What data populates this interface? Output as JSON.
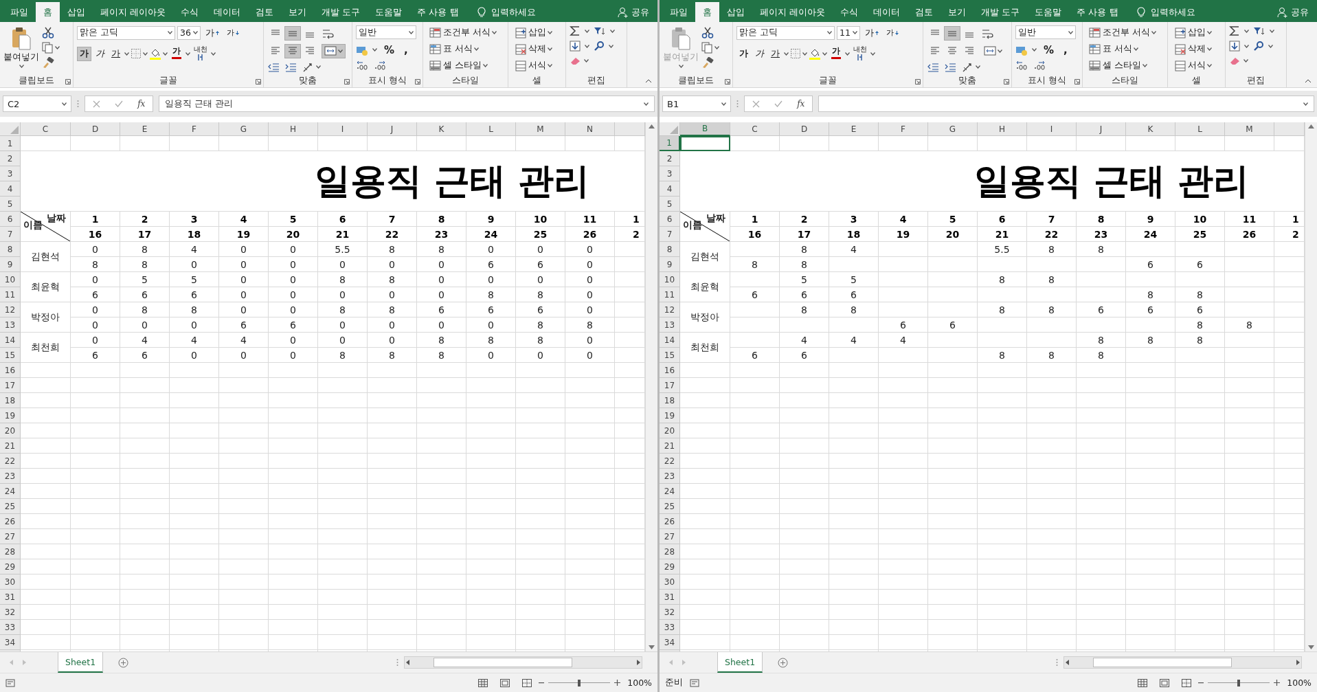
{
  "panes": [
    {
      "tabs": [
        {
          "label": "파일",
          "selected": false
        },
        {
          "label": "홈",
          "selected": true
        },
        {
          "label": "삽입",
          "selected": false
        },
        {
          "label": "페이지 레이아웃",
          "selected": false
        },
        {
          "label": "수식",
          "selected": false
        },
        {
          "label": "데이터",
          "selected": false
        },
        {
          "label": "검토",
          "selected": false
        },
        {
          "label": "보기",
          "selected": false
        },
        {
          "label": "개발 도구",
          "selected": false
        },
        {
          "label": "도움말",
          "selected": false
        },
        {
          "label": "주 사용 탭",
          "selected": false
        }
      ],
      "tell_me": "입력하세요",
      "share": "공유",
      "ribbon": {
        "paste": {
          "label": "붙여넣기",
          "disabled": false
        },
        "font_name": "맑은 고딕",
        "font_size": "36",
        "font_buttons": [
          {
            "kind": "grow",
            "label": "가",
            "pressed": false
          },
          {
            "kind": "shrink",
            "label": "가",
            "pressed": false
          },
          {
            "kind": "bold",
            "label": "가",
            "pressed": true
          },
          {
            "kind": "italic",
            "label": "가",
            "pressed": false
          },
          {
            "kind": "underline",
            "label": "가",
            "pressed": false
          }
        ],
        "font_color": "가",
        "phonetic": "내천",
        "alignment": {
          "top": false,
          "middle": true,
          "bottom": false,
          "left": false,
          "center": true,
          "right": false,
          "merge": true
        },
        "number_format": "일반",
        "percent": "%",
        "comma": ",",
        "styles": [
          "조건부 서식",
          "표 서식",
          "셀 스타일"
        ],
        "cells": [
          "삽입",
          "삭제",
          "서식"
        ],
        "groups": [
          "클립보드",
          "글꼴",
          "맞춤",
          "표시 형식",
          "스타일",
          "셀",
          "편집"
        ]
      },
      "name_box": "C2",
      "fx": "fx",
      "formula": "일용직 근태 관리",
      "grid": {
        "columns": [
          {
            "label": "C",
            "selected": false
          },
          {
            "label": "D",
            "selected": false
          },
          {
            "label": "E",
            "selected": false
          },
          {
            "label": "F",
            "selected": false
          },
          {
            "label": "G",
            "selected": false
          },
          {
            "label": "H",
            "selected": false
          },
          {
            "label": "I",
            "selected": false
          },
          {
            "label": "J",
            "selected": false
          },
          {
            "label": "K",
            "selected": false
          },
          {
            "label": "L",
            "selected": false
          },
          {
            "label": "M",
            "selected": false
          },
          {
            "label": "N",
            "selected": false
          }
        ],
        "row_numbers": [
          {
            "label": "1",
            "selected": false
          },
          {
            "label": "2",
            "selected": false
          },
          {
            "label": "3",
            "selected": false
          },
          {
            "label": "4",
            "selected": false
          },
          {
            "label": "5",
            "selected": false
          },
          {
            "label": "6",
            "selected": false
          },
          {
            "label": "7",
            "selected": false
          },
          {
            "label": "8",
            "selected": false
          },
          {
            "label": "9",
            "selected": false
          },
          {
            "label": "10",
            "selected": false
          },
          {
            "label": "11",
            "selected": false
          },
          {
            "label": "12",
            "selected": false
          },
          {
            "label": "13",
            "selected": false
          },
          {
            "label": "14",
            "selected": false
          },
          {
            "label": "15",
            "selected": false
          },
          {
            "label": "16",
            "selected": false
          },
          {
            "label": "17",
            "selected": false
          },
          {
            "label": "18",
            "selected": false
          },
          {
            "label": "19",
            "selected": false
          },
          {
            "label": "20",
            "selected": false
          },
          {
            "label": "21",
            "selected": false
          },
          {
            "label": "22",
            "selected": false
          },
          {
            "label": "23",
            "selected": false
          },
          {
            "label": "24",
            "selected": false
          },
          {
            "label": "25",
            "selected": false
          },
          {
            "label": "26",
            "selected": false
          },
          {
            "label": "27",
            "selected": false
          },
          {
            "label": "28",
            "selected": false
          },
          {
            "label": "29",
            "selected": false
          },
          {
            "label": "30",
            "selected": false
          },
          {
            "label": "31",
            "selected": false
          },
          {
            "label": "32",
            "selected": false
          },
          {
            "label": "33",
            "selected": false
          },
          {
            "label": "34",
            "selected": false
          }
        ],
        "title": "일용직 근태 관리",
        "header_top": "날짜",
        "header_bottom": "이름",
        "days": [
          "1",
          "2",
          "3",
          "4",
          "5",
          "6",
          "7",
          "8",
          "9",
          "10",
          "11",
          "1"
        ],
        "dates": [
          "16",
          "17",
          "18",
          "19",
          "20",
          "21",
          "22",
          "23",
          "24",
          "25",
          "26",
          "2"
        ],
        "people": [
          {
            "name": "김현석",
            "hours": [
              [
                "0",
                "8",
                "4",
                "0",
                "0",
                "5.5",
                "8",
                "8",
                "0",
                "0",
                "0"
              ],
              [
                "8",
                "8",
                "0",
                "0",
                "0",
                "0",
                "0",
                "0",
                "6",
                "6",
                "0"
              ]
            ]
          },
          {
            "name": "최윤혁",
            "hours": [
              [
                "0",
                "5",
                "5",
                "0",
                "0",
                "8",
                "8",
                "0",
                "0",
                "0",
                "0"
              ],
              [
                "6",
                "6",
                "6",
                "0",
                "0",
                "0",
                "0",
                "0",
                "8",
                "8",
                "0"
              ]
            ]
          },
          {
            "name": "박정아",
            "hours": [
              [
                "0",
                "8",
                "8",
                "0",
                "0",
                "8",
                "8",
                "6",
                "6",
                "6",
                "0"
              ],
              [
                "0",
                "0",
                "0",
                "6",
                "6",
                "0",
                "0",
                "0",
                "0",
                "8",
                "8"
              ]
            ]
          },
          {
            "name": "최천희",
            "hours": [
              [
                "0",
                "4",
                "4",
                "4",
                "0",
                "0",
                "0",
                "8",
                "8",
                "8",
                "0"
              ],
              [
                "6",
                "6",
                "0",
                "0",
                "0",
                "8",
                "8",
                "8",
                "0",
                "0",
                "0"
              ]
            ]
          }
        ]
      },
      "sheet_tab": {
        "label": "Sheet1",
        "selected": true
      },
      "zoom_slider": {
        "level": 0.5
      },
      "zoom": "100%"
    },
    {
      "tabs": [
        {
          "label": "파일",
          "selected": false
        },
        {
          "label": "홈",
          "selected": true
        },
        {
          "label": "삽입",
          "selected": false
        },
        {
          "label": "페이지 레이아웃",
          "selected": false
        },
        {
          "label": "수식",
          "selected": false
        },
        {
          "label": "데이터",
          "selected": false
        },
        {
          "label": "검토",
          "selected": false
        },
        {
          "label": "보기",
          "selected": false
        },
        {
          "label": "개발 도구",
          "selected": false
        },
        {
          "label": "도움말",
          "selected": false
        },
        {
          "label": "주 사용 탭",
          "selected": false
        }
      ],
      "tell_me": "입력하세요",
      "share": "공유",
      "ribbon": {
        "paste": {
          "label": "붙여넣기",
          "disabled": true
        },
        "font_name": "맑은 고딕",
        "font_size": "11",
        "font_buttons": [
          {
            "kind": "grow",
            "label": "가",
            "pressed": false
          },
          {
            "kind": "shrink",
            "label": "가",
            "pressed": false
          },
          {
            "kind": "bold",
            "label": "가",
            "pressed": false
          },
          {
            "kind": "italic",
            "label": "가",
            "pressed": false
          },
          {
            "kind": "underline",
            "label": "가",
            "pressed": false
          }
        ],
        "font_color": "가",
        "phonetic": "내천",
        "alignment": {
          "top": false,
          "middle": true,
          "bottom": false,
          "left": false,
          "center": false,
          "right": false,
          "merge": false
        },
        "number_format": "일반",
        "percent": "%",
        "comma": ",",
        "styles": [
          "조건부 서식",
          "표 서식",
          "셀 스타일"
        ],
        "cells": [
          "삽입",
          "삭제",
          "서식"
        ],
        "groups": [
          "클립보드",
          "글꼴",
          "맞춤",
          "표시 형식",
          "스타일",
          "셀",
          "편집"
        ]
      },
      "name_box": "B1",
      "fx": "fx",
      "grid": {
        "columns": [
          {
            "label": "B",
            "selected": true
          },
          {
            "label": "C",
            "selected": false
          },
          {
            "label": "D",
            "selected": false
          },
          {
            "label": "E",
            "selected": false
          },
          {
            "label": "F",
            "selected": false
          },
          {
            "label": "G",
            "selected": false
          },
          {
            "label": "H",
            "selected": false
          },
          {
            "label": "I",
            "selected": false
          },
          {
            "label": "J",
            "selected": false
          },
          {
            "label": "K",
            "selected": false
          },
          {
            "label": "L",
            "selected": false
          },
          {
            "label": "M",
            "selected": false
          }
        ],
        "row_numbers": [
          {
            "label": "1",
            "selected": true
          },
          {
            "label": "2",
            "selected": false
          },
          {
            "label": "3",
            "selected": false
          },
          {
            "label": "4",
            "selected": false
          },
          {
            "label": "5",
            "selected": false
          },
          {
            "label": "6",
            "selected": false
          },
          {
            "label": "7",
            "selected": false
          },
          {
            "label": "8",
            "selected": false
          },
          {
            "label": "9",
            "selected": false
          },
          {
            "label": "10",
            "selected": false
          },
          {
            "label": "11",
            "selected": false
          },
          {
            "label": "12",
            "selected": false
          },
          {
            "label": "13",
            "selected": false
          },
          {
            "label": "14",
            "selected": false
          },
          {
            "label": "15",
            "selected": false
          },
          {
            "label": "16",
            "selected": false
          },
          {
            "label": "17",
            "selected": false
          },
          {
            "label": "18",
            "selected": false
          },
          {
            "label": "19",
            "selected": false
          },
          {
            "label": "20",
            "selected": false
          },
          {
            "label": "21",
            "selected": false
          },
          {
            "label": "22",
            "selected": false
          },
          {
            "label": "23",
            "selected": false
          },
          {
            "label": "24",
            "selected": false
          },
          {
            "label": "25",
            "selected": false
          },
          {
            "label": "26",
            "selected": false
          },
          {
            "label": "27",
            "selected": false
          },
          {
            "label": "28",
            "selected": false
          },
          {
            "label": "29",
            "selected": false
          },
          {
            "label": "30",
            "selected": false
          },
          {
            "label": "31",
            "selected": false
          },
          {
            "label": "32",
            "selected": false
          },
          {
            "label": "33",
            "selected": false
          },
          {
            "label": "34",
            "selected": false
          }
        ],
        "title": "일용직 근태 관리",
        "header_top": "날짜",
        "header_bottom": "이름",
        "days": [
          "1",
          "2",
          "3",
          "4",
          "5",
          "6",
          "7",
          "8",
          "9",
          "10",
          "11",
          "1"
        ],
        "dates": [
          "16",
          "17",
          "18",
          "19",
          "20",
          "21",
          "22",
          "23",
          "24",
          "25",
          "26",
          "2"
        ],
        "people": [
          {
            "name": "김현석",
            "hours": [
              [
                {
                  "kind": "empty"
                },
                "8",
                "4",
                {
                  "kind": "empty"
                },
                {
                  "kind": "empty"
                },
                "5.5",
                "8",
                "8",
                {
                  "kind": "empty"
                },
                {
                  "kind": "empty"
                },
                {
                  "kind": "empty"
                }
              ],
              [
                "8",
                "8",
                {
                  "kind": "empty"
                },
                {
                  "kind": "empty"
                },
                {
                  "kind": "empty"
                },
                {
                  "kind": "empty"
                },
                {
                  "kind": "empty"
                },
                {
                  "kind": "empty"
                },
                "6",
                "6",
                {
                  "kind": "empty"
                }
              ]
            ]
          },
          {
            "name": "최윤혁",
            "hours": [
              [
                {
                  "kind": "empty"
                },
                "5",
                "5",
                {
                  "kind": "empty"
                },
                {
                  "kind": "empty"
                },
                "8",
                "8",
                {
                  "kind": "empty"
                },
                {
                  "kind": "empty"
                },
                {
                  "kind": "empty"
                },
                {
                  "kind": "empty"
                }
              ],
              [
                "6",
                "6",
                "6",
                {
                  "kind": "empty"
                },
                {
                  "kind": "empty"
                },
                {
                  "kind": "empty"
                },
                {
                  "kind": "empty"
                },
                {
                  "kind": "empty"
                },
                "8",
                "8",
                {
                  "kind": "empty"
                }
              ]
            ]
          },
          {
            "name": "박정아",
            "hours": [
              [
                {
                  "kind": "empty"
                },
                "8",
                "8",
                {
                  "kind": "empty"
                },
                {
                  "kind": "empty"
                },
                "8",
                "8",
                "6",
                "6",
                "6",
                {
                  "kind": "empty"
                }
              ],
              [
                {
                  "kind": "empty"
                },
                {
                  "kind": "empty"
                },
                {
                  "kind": "empty"
                },
                "6",
                "6",
                {
                  "kind": "empty"
                },
                {
                  "kind": "empty"
                },
                {
                  "kind": "empty"
                },
                {
                  "kind": "empty"
                },
                "8",
                "8"
              ]
            ]
          },
          {
            "name": "최천희",
            "hours": [
              [
                {
                  "kind": "empty"
                },
                "4",
                "4",
                "4",
                {
                  "kind": "empty"
                },
                {
                  "kind": "empty"
                },
                {
                  "kind": "empty"
                },
                "8",
                "8",
                "8",
                {
                  "kind": "empty"
                }
              ],
              [
                "6",
                "6",
                {
                  "kind": "empty"
                },
                {
                  "kind": "empty"
                },
                {
                  "kind": "empty"
                },
                "8",
                "8",
                "8",
                {
                  "kind": "empty"
                },
                {
                  "kind": "empty"
                },
                {
                  "kind": "empty"
                }
              ]
            ]
          }
        ]
      },
      "sheet_tab": {
        "label": "Sheet1",
        "selected": true
      },
      "status": "준비",
      "zoom_slider": {
        "level": 0.5
      },
      "zoom": "100%"
    }
  ]
}
